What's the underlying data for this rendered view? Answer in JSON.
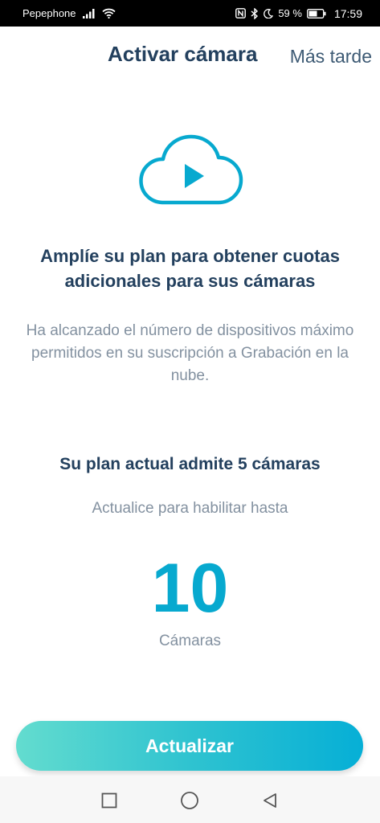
{
  "status_bar": {
    "carrier": "Pepephone",
    "battery_percent": "59 %",
    "time": "17:59",
    "icons": [
      "signal-icon",
      "wifi-icon",
      "nfc-icon",
      "bluetooth-icon",
      "moon-icon",
      "battery-icon"
    ]
  },
  "header": {
    "title": "Activar cámara",
    "later_label": "Más tarde"
  },
  "hero": {
    "icon": "cloud-play-icon",
    "accent_color": "#07a9cf"
  },
  "content": {
    "headline": "Amplíe su plan para obtener cuotas adicionales para sus cámaras",
    "description": "Ha alcanzado el número de dispositivos máximo permitidos en su suscripción a Grabación en la nube.",
    "current_plan": "Su plan actual admite 5 cámaras",
    "upgrade_hint": "Actualice para habilitar hasta",
    "camera_count": "10",
    "camera_unit": "Cámaras"
  },
  "actions": {
    "upgrade_label": "Actualizar"
  },
  "nav_bar": {
    "buttons": [
      "recent-apps-icon",
      "home-icon",
      "back-icon"
    ]
  },
  "colors": {
    "title": "#23405e",
    "secondary_text": "#8391a0",
    "accent": "#07a9cf",
    "button_gradient_start": "#63dccf",
    "button_gradient_end": "#06afd6"
  }
}
